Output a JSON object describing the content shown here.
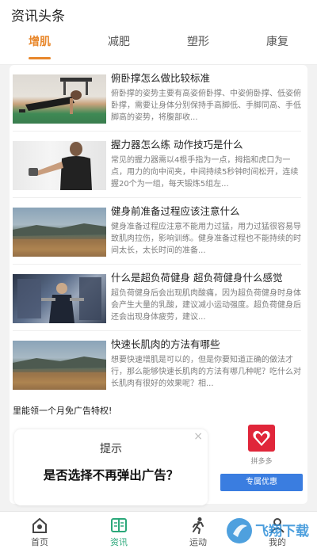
{
  "header": {
    "title": "资讯头条"
  },
  "tabs": [
    {
      "label": "增肌",
      "active": true
    },
    {
      "label": "减肥"
    },
    {
      "label": "塑形"
    },
    {
      "label": "康复"
    }
  ],
  "articles": [
    {
      "title": "俯卧撑怎么做比较标准",
      "desc": "俯卧撑的姿势主要有高姿俯卧撑、中姿俯卧撑、低姿俯卧撑，需要让身体分别保持手高脚低、手脚同高、手低脚高的姿势，将腹部收..."
    },
    {
      "title": "握力器怎么练 动作技巧是什么",
      "desc": "常见的握力器需以4根手指为一点，拇指和虎口为一点，用力的向中间夹，中间持续5秒钟时间松开，连续握20个为一组，每天锻炼5组左..."
    },
    {
      "title": "健身前准备过程应该注意什么",
      "desc": "健身准备过程应注意不能用力过猛，用力过猛很容易导致肌肉拉伤，影响训练。健身准备过程也不能持续的时间太长，太长时间的准备..."
    },
    {
      "title": "什么是超负荷健身 超负荷健身什么感觉",
      "desc": "超负荷健身后会出现肌肉酸痛，因为超负荷健身时身体会产生大量的乳酸，建议减小运动强度。超负荷健身后还会出现身体疲劳，建议..."
    },
    {
      "title": "快速长肌肉的方法有哪些",
      "desc": "想要快速增肌是可以的，但是你要知道正确的做法才行，那么能够快速长肌肉的方法有哪几种呢？吃什么对长肌肉有很好的效果呢？相..."
    }
  ],
  "promo": {
    "text": "里能领一个月免广告特权!"
  },
  "dialog": {
    "title": "提示",
    "message": "是否选择不再弹出广告？",
    "close": "×"
  },
  "ad": {
    "name": "拼多多",
    "button": "专属优惠"
  },
  "bottom_nav": [
    {
      "label": "首页",
      "icon": "home-icon"
    },
    {
      "label": "资讯",
      "icon": "news-icon",
      "active": true
    },
    {
      "label": "运动",
      "icon": "run-icon"
    },
    {
      "label": "我的",
      "icon": "profile-icon"
    }
  ],
  "watermark": {
    "text": "飞翔下载"
  },
  "colors": {
    "accent": "#e8872b",
    "nav_active": "#2ba87a",
    "ad_button": "#3a7de0",
    "ad_logo": "#e0263a"
  }
}
